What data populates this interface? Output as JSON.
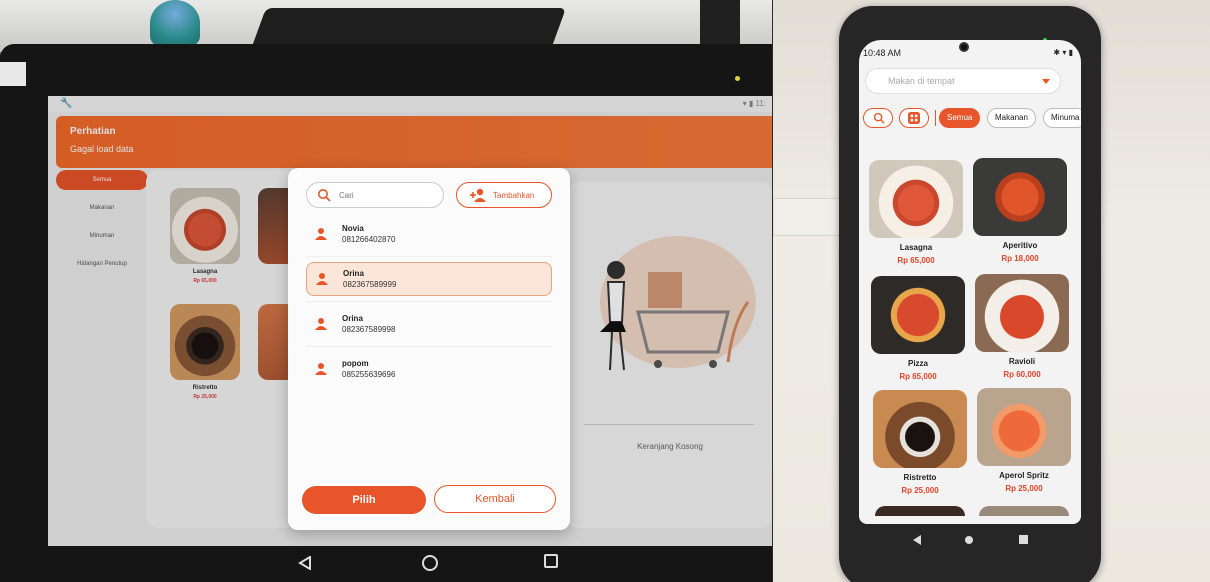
{
  "tablet": {
    "banner": {
      "title": "Perhatian",
      "message": "Gagal load data"
    },
    "categories": [
      "Semua",
      "Makanan",
      "Minuman",
      "Hidangan Penutup"
    ],
    "menu": [
      {
        "name": "Lasagna",
        "price": "Rp 65,000"
      },
      {
        "name": "Ristretto",
        "price": "Rp 25,000"
      }
    ],
    "cart": {
      "empty_text": "Keranjang Kosong"
    },
    "dialog": {
      "search_placeholder": "Cari",
      "add_label": "Tambahkan",
      "customers": [
        {
          "name": "Novia",
          "phone": "081266402870"
        },
        {
          "name": "Orina",
          "phone": "082367589999"
        },
        {
          "name": "Orina",
          "phone": "082367589998"
        },
        {
          "name": "popom",
          "phone": "085255639696"
        }
      ],
      "selected_index": 1,
      "confirm_label": "Pilih",
      "back_label": "Kembali"
    }
  },
  "phone": {
    "time": "10:48 AM",
    "order_type": "Makan di tempat",
    "categories": [
      "Semua",
      "Makanan",
      "Minuma"
    ],
    "menu": [
      {
        "name": "Lasagna",
        "price": "Rp 65,000"
      },
      {
        "name": "Aperitivo",
        "price": "Rp 18,000"
      },
      {
        "name": "Pizza",
        "price": "Rp 65,000"
      },
      {
        "name": "Ravioli",
        "price": "Rp 60,000"
      },
      {
        "name": "Ristretto",
        "price": "Rp 25,000"
      },
      {
        "name": "Aperol Spritz",
        "price": "Rp 25,000"
      }
    ]
  },
  "colors": {
    "accent": "#e8552a",
    "price": "#e2452a",
    "banner": "#f26a2a"
  },
  "icons": [
    "search-icon",
    "add-person-icon",
    "person-icon",
    "grid-icon",
    "back-icon",
    "home-icon",
    "recents-icon",
    "chevron-down-icon"
  ]
}
